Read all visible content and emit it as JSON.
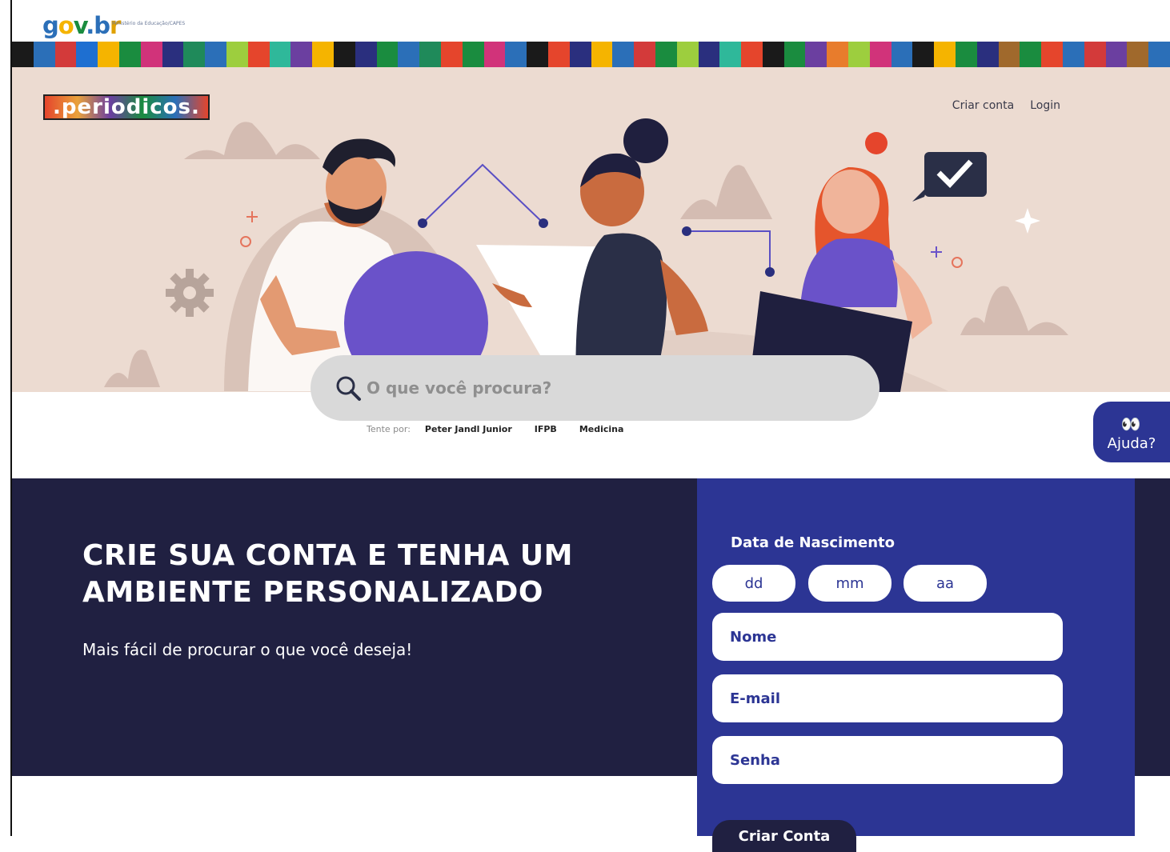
{
  "gov": {
    "logo": "gov.br",
    "subtitle": "Ministério da Educação/CAPES"
  },
  "stripe_colors": [
    "#1a1a1a",
    "#2b6fb8",
    "#d33a3a",
    "#1e6fd1",
    "#f5b400",
    "#1a8c3f",
    "#d1337a",
    "#2a2f7e",
    "#1f8a5a",
    "#2b6fb8",
    "#9dce3e",
    "#e5452c",
    "#2fb89a",
    "#6b3fa0",
    "#f5b400",
    "#1a1a1a",
    "#2a2f7e",
    "#1a8c3f",
    "#2b6fb8",
    "#1f8a5a",
    "#e5452c",
    "#1a8c3f",
    "#d1337a",
    "#2b6fb8",
    "#1a1a1a",
    "#e5452c",
    "#2a2f7e",
    "#f5b400",
    "#2b6fb8",
    "#d33a3a",
    "#1a8c3f",
    "#9dce3e",
    "#2a2f7e",
    "#2fb89a",
    "#e5452c",
    "#1a1a1a",
    "#1a8c3f",
    "#6b3fa0",
    "#e87c2c",
    "#9dce3e",
    "#d1337a",
    "#2b6fb8",
    "#1a1a1a",
    "#f5b400",
    "#1a8c3f",
    "#2a2f7e",
    "#a0692c",
    "#1a8c3f",
    "#e5452c",
    "#2b6fb8",
    "#d33a3a",
    "#6b3fa0",
    "#a0692c",
    "#2b6fb8"
  ],
  "header": {
    "brand": ".periodicos.",
    "create_account": "Criar conta",
    "login": "Login"
  },
  "search": {
    "placeholder": "O que você procura?",
    "suggest_label": "Tente por:",
    "suggestions": [
      "Peter Jandl Junior",
      "IFPB",
      "Medicina"
    ]
  },
  "help": {
    "label": "Ajuda?"
  },
  "promo": {
    "headline": "CRIE SUA CONTA E TENHA UM AMBIENTE PERSONALIZADO",
    "subline": "Mais fácil de procurar o que você deseja!"
  },
  "form": {
    "dob_label": "Data de Nascimento",
    "day_placeholder": "dd",
    "month_placeholder": "mm",
    "year_placeholder": "aa",
    "name_placeholder": "Nome",
    "email_placeholder": "E-mail",
    "password_placeholder": "Senha",
    "submit_label": "Criar Conta"
  },
  "colors": {
    "hero_bg": "#ecdbd1",
    "navy": "#202041",
    "blue": "#2c3594",
    "purple": "#6a52c9"
  }
}
